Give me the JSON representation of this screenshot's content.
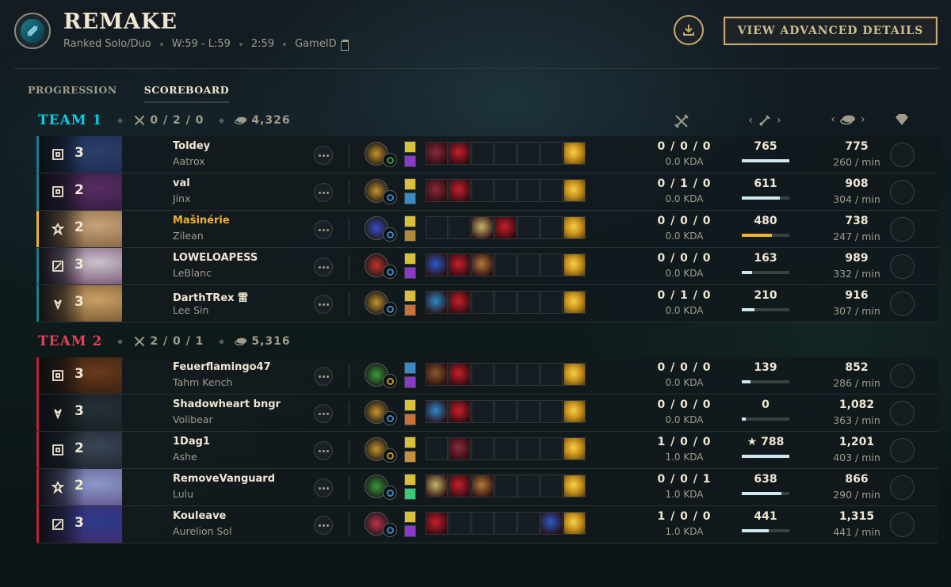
{
  "header": {
    "title": "REMAKE",
    "queue": "Ranked Solo/Duo",
    "record": "W:59 - L:59",
    "duration": "2:59",
    "game_id_label": "GameID",
    "advanced_button": "VIEW ADVANCED DETAILS"
  },
  "tabs": [
    {
      "label": "PROGRESSION",
      "active": false
    },
    {
      "label": "SCOREBOARD",
      "active": true
    }
  ],
  "teams": [
    {
      "name": "TEAM 1",
      "color": "#0acbe6",
      "kda": "0 / 2 / 0",
      "gold": "4,326",
      "accent": "#1a7d8c",
      "players": [
        {
          "level": "3",
          "name": "Toldey",
          "champion": "Aatrox",
          "kda": "0 / 0 / 0",
          "kda_ratio": "0.0 KDA",
          "cs": "765",
          "cs_bar": 1.0,
          "gold": "775",
          "gpm": "260 / min"
        },
        {
          "level": "2",
          "name": "val",
          "champion": "Jinx",
          "kda": "0 / 1 / 0",
          "kda_ratio": "0.0 KDA",
          "cs": "611",
          "cs_bar": 0.8,
          "gold": "908",
          "gpm": "304 / min"
        },
        {
          "level": "2",
          "name": "Mašinérie",
          "champion": "Zilean",
          "kda": "0 / 0 / 0",
          "kda_ratio": "0.0 KDA",
          "cs": "480",
          "cs_bar": 0.63,
          "gold": "738",
          "gpm": "247 / min",
          "self": true
        },
        {
          "level": "3",
          "name": "LOWELOAPESS",
          "champion": "LeBlanc",
          "kda": "0 / 0 / 0",
          "kda_ratio": "0.0 KDA",
          "cs": "163",
          "cs_bar": 0.21,
          "gold": "989",
          "gpm": "332 / min"
        },
        {
          "level": "3",
          "name": "DarthTRex 雷",
          "champion": "Lee Sin",
          "kda": "0 / 1 / 0",
          "kda_ratio": "0.0 KDA",
          "cs": "210",
          "cs_bar": 0.27,
          "gold": "916",
          "gpm": "307 / min"
        }
      ]
    },
    {
      "name": "TEAM 2",
      "color": "#e84057",
      "kda": "2 / 0 / 1",
      "gold": "5,316",
      "accent": "#b62236",
      "players": [
        {
          "level": "3",
          "name": "Feuerflamingo47",
          "champion": "Tahm Kench",
          "kda": "0 / 0 / 0",
          "kda_ratio": "0.0 KDA",
          "cs": "139",
          "cs_bar": 0.18,
          "gold": "852",
          "gpm": "286 / min"
        },
        {
          "level": "3",
          "name": "Shadowheart bngr",
          "champion": "Volibear",
          "kda": "0 / 0 / 0",
          "kda_ratio": "0.0 KDA",
          "cs": "0",
          "cs_bar": 0.08,
          "gold": "1,082",
          "gpm": "363 / min"
        },
        {
          "level": "2",
          "name": "1Dag1",
          "champion": "Ashe",
          "kda": "1 / 0 / 0",
          "kda_ratio": "1.0 KDA",
          "cs": "★ 788",
          "cs_bar": 1.0,
          "gold": "1,201",
          "gpm": "403 / min"
        },
        {
          "level": "2",
          "name": "RemoveVanguard",
          "champion": "Lulu",
          "kda": "0 / 0 / 1",
          "kda_ratio": "1.0 KDA",
          "cs": "638",
          "cs_bar": 0.83,
          "gold": "866",
          "gpm": "290 / min"
        },
        {
          "level": "3",
          "name": "Kouleave",
          "champion": "Aurelion Sol",
          "kda": "1 / 0 / 0",
          "kda_ratio": "1.0 KDA",
          "cs": "441",
          "cs_bar": 0.56,
          "gold": "1,315",
          "gpm": "441 / min"
        }
      ]
    }
  ]
}
